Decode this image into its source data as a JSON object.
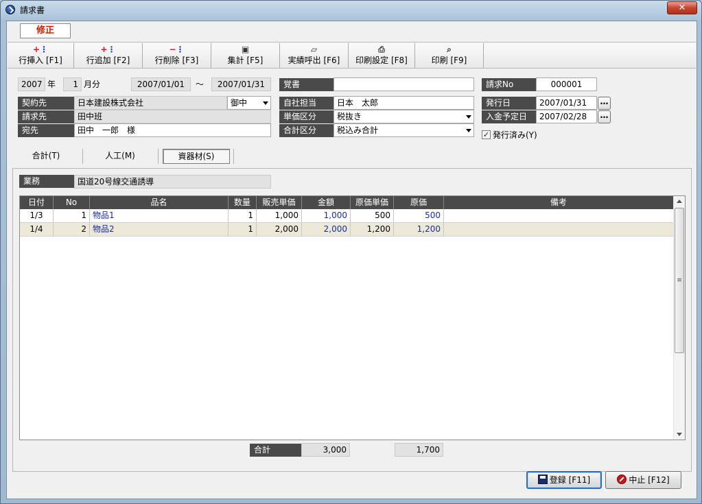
{
  "window": {
    "title": "請求書",
    "close_glyph": "✕"
  },
  "mode": "修正",
  "toolbar": [
    {
      "name": "row-insert",
      "label": "行挿入 [F1]",
      "icon": "row-insert-icon",
      "glyph": "+⋮"
    },
    {
      "name": "row-add",
      "label": "行追加 [F2]",
      "icon": "row-add-icon",
      "glyph": "+⋮"
    },
    {
      "name": "row-delete",
      "label": "行削除 [F3]",
      "icon": "row-delete-icon",
      "glyph": "−⋮"
    },
    {
      "name": "aggregate",
      "label": "集計 [F5]",
      "icon": "aggregate-icon",
      "glyph": "▣"
    },
    {
      "name": "load-actual",
      "label": "実績呼出 [F6]",
      "icon": "folder-open-icon",
      "glyph": "▱"
    },
    {
      "name": "print-settings",
      "label": "印刷設定 [F8]",
      "icon": "printer-icon",
      "glyph": "⎙"
    },
    {
      "name": "print",
      "label": "印刷 [F9]",
      "icon": "print-preview-icon",
      "glyph": "⌕"
    }
  ],
  "header": {
    "year": "2007",
    "year_unit": "年",
    "month": "1",
    "month_unit": "月分",
    "date_from": "2007/01/01",
    "tilde": "～",
    "date_to": "2007/01/31",
    "memo_label": "覚書",
    "memo_value": "",
    "invoice_no_label": "請求No",
    "invoice_no": "000001",
    "contractor_label": "契約先",
    "contractor": "日本建設株式会社",
    "honorific": "御中",
    "billing_label": "請求先",
    "billing": "田中班",
    "addressee_label": "宛先",
    "addressee": "田中　一郎　様",
    "staff_label": "自社担当",
    "staff": "日本　太郎",
    "unit_price_type_label": "単価区分",
    "unit_price_type": "税抜き",
    "total_type_label": "合計区分",
    "total_type": "税込み合計",
    "issue_date_label": "発行日",
    "issue_date": "2007/01/31",
    "payment_date_label": "入金予定日",
    "payment_date": "2007/02/28",
    "issued_label": "発行済み(Y)",
    "issued_checked": true
  },
  "tabs": [
    {
      "label": "合計(T)",
      "active": false
    },
    {
      "label": "人工(M)",
      "active": false
    },
    {
      "label": "資器材(S)",
      "active": true
    }
  ],
  "panel": {
    "business_label": "業務",
    "business": "国道20号線交通誘導",
    "columns": [
      "日付",
      "No",
      "品名",
      "数量",
      "販売単価",
      "金額",
      "原価単価",
      "原価",
      "備考"
    ],
    "rows": [
      {
        "date": "1/3",
        "no": "1",
        "item": "物品1",
        "qty": "1",
        "unit_price": "1,000",
        "amount": "1,000",
        "cost_unit": "500",
        "cost": "500",
        "note": ""
      },
      {
        "date": "1/4",
        "no": "2",
        "item": "物品2",
        "qty": "1",
        "unit_price": "2,000",
        "amount": "2,000",
        "cost_unit": "1,200",
        "cost": "1,200",
        "note": ""
      }
    ],
    "total_label": "合計",
    "total_amount": "3,000",
    "total_cost": "1,700"
  },
  "buttons": {
    "register": "登録 [F11]",
    "cancel": "中止 [F12]"
  },
  "colors": {
    "selected_row": "#ece9d8",
    "label_bg": "#4a4a4a",
    "mode_text": "#d02000",
    "link_blue": "#1a2aa8"
  }
}
